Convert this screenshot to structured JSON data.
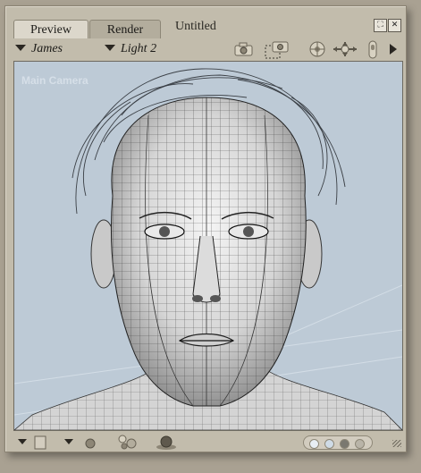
{
  "tabs": [
    {
      "label": "Preview",
      "active": true
    },
    {
      "label": "Render",
      "active": false
    }
  ],
  "document_title": "Untitled",
  "window_buttons": [
    {
      "icon": "maximize-icon",
      "glyph": "⛶"
    },
    {
      "icon": "close-icon",
      "glyph": "✕"
    }
  ],
  "toolbar": {
    "figure_select": "James",
    "light_select": "Light 2",
    "icons": [
      "camera-icon",
      "render-camera-icon",
      "sphere-control-icon",
      "move-arrows-icon",
      "trackball-icon",
      "arrow-right-icon"
    ]
  },
  "viewport": {
    "camera_label": "Main Camera",
    "background": "#bdcad6",
    "subject": "wireframe-head-icon"
  },
  "bottom_bar": {
    "icons": [
      "display-style-icon",
      "shading-sphere-icon",
      "lights-icon",
      "ground-sphere-icon",
      "grip-icon"
    ],
    "preview_dots": [
      "#e8eef4",
      "#cfdbe6",
      "#7a7870",
      "#b9b4a8"
    ]
  },
  "colors": {
    "window_bg": "#c2bcac",
    "desktop_bg": "#a9a192"
  }
}
